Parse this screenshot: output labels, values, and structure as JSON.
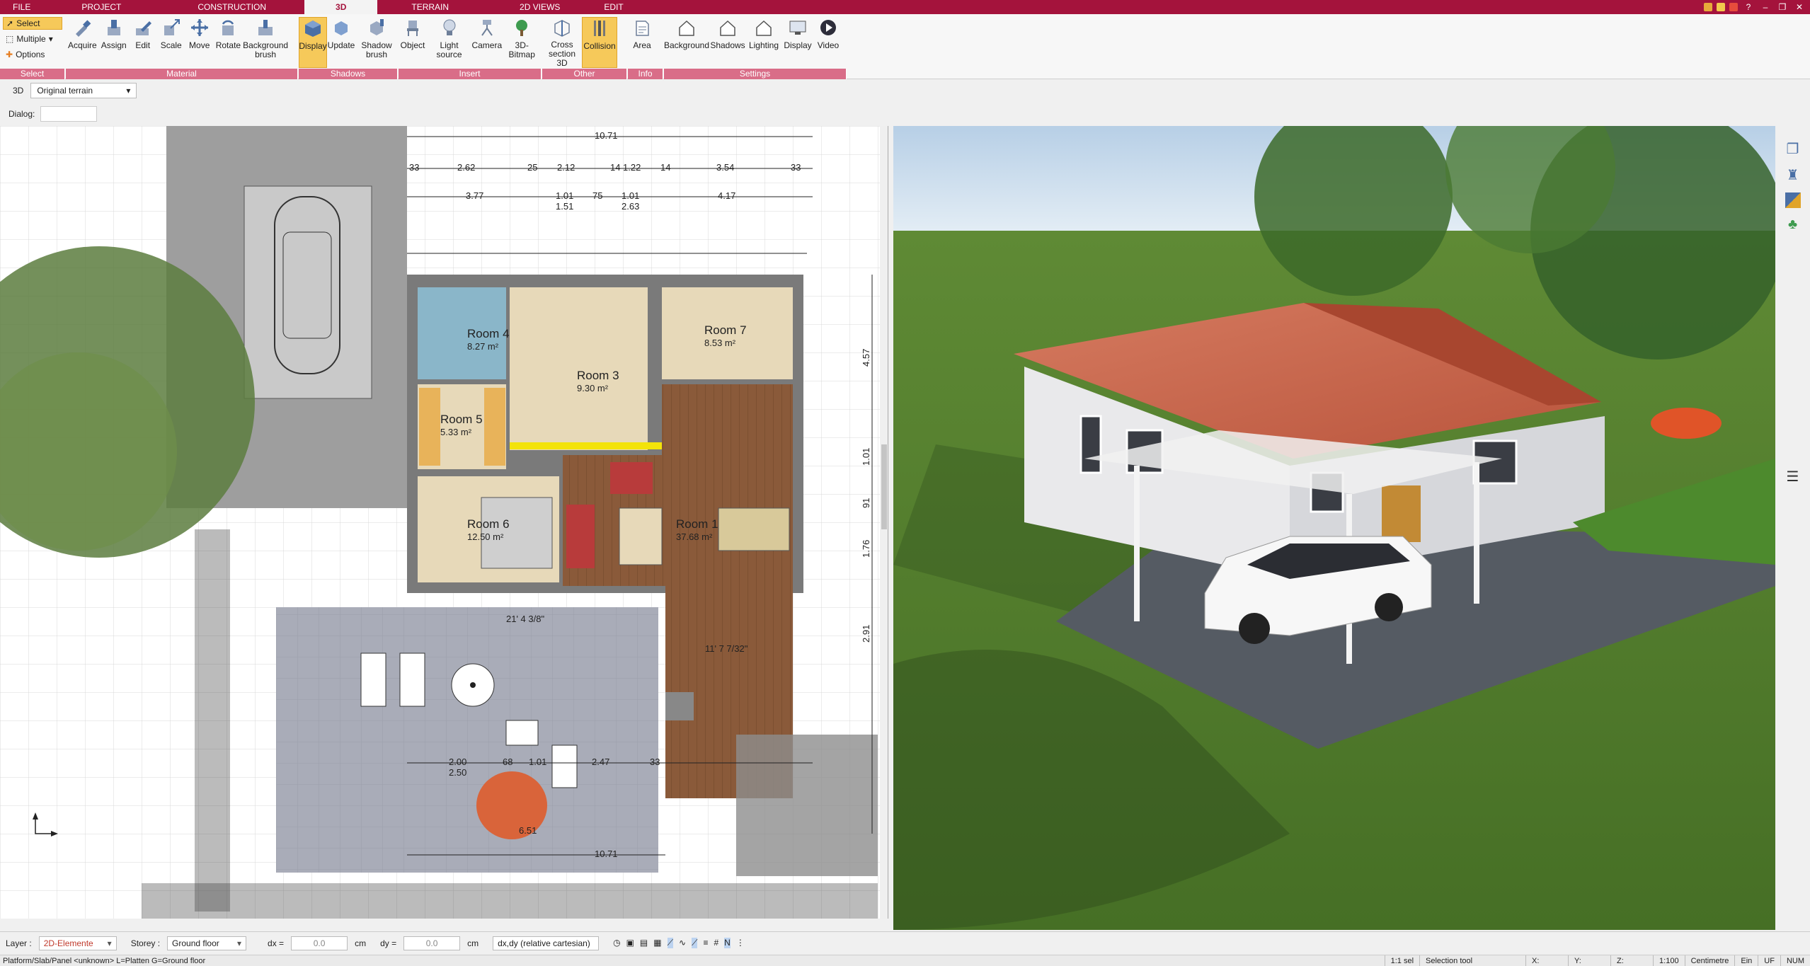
{
  "tabs": [
    {
      "label": "FILE"
    },
    {
      "label": "PROJECT"
    },
    {
      "label": "CONSTRUCTION"
    },
    {
      "label": "3D"
    },
    {
      "label": "TERRAIN"
    },
    {
      "label": "2D VIEWS"
    },
    {
      "label": "EDIT"
    }
  ],
  "ribbon": {
    "select": {
      "select_label": "Select",
      "multiple_label": "Multiple",
      "options_label": "Options",
      "group": "Select"
    },
    "material": {
      "group": "Material",
      "buttons": [
        "Acquire",
        "Assign",
        "Edit",
        "Scale",
        "Move",
        "Rotate",
        "Background brush"
      ]
    },
    "shadows": {
      "group": "Shadows",
      "buttons": [
        "Display",
        "Update",
        "Shadow brush"
      ]
    },
    "insert": {
      "group": "Insert",
      "buttons": [
        "Object",
        "Light source",
        "Camera",
        "3D-Bitmap"
      ]
    },
    "other": {
      "group": "Other",
      "buttons": [
        "Cross section 3D",
        "Collision"
      ]
    },
    "info": {
      "group": "Info",
      "buttons": [
        "Area"
      ]
    },
    "settings": {
      "group": "Settings",
      "buttons": [
        "Background",
        "Shadows",
        "Lighting",
        "Display",
        "Video"
      ]
    }
  },
  "subbar": {
    "mode": "3D",
    "terrain": "Original terrain"
  },
  "dialog": {
    "label": "Dialog:"
  },
  "plan": {
    "dims_top": [
      "10.71",
      "33",
      "2.62",
      "25",
      "2.12",
      "14",
      "1.22",
      "14",
      "3.54",
      "33",
      "3.77",
      "1.01",
      "75",
      "1.01",
      "4.17",
      "1.51",
      "2.63"
    ],
    "rooms": [
      {
        "name": "Room 4",
        "area": "8.27 m²"
      },
      {
        "name": "Room 7",
        "area": "8.53 m²"
      },
      {
        "name": "Room 3",
        "area": "9.30 m²"
      },
      {
        "name": "Room 5",
        "area": "5.33 m²"
      },
      {
        "name": "Room 6",
        "area": "12.50 m²"
      },
      {
        "name": "Room 1",
        "area": "37.68 m²"
      }
    ],
    "dims_bottom": [
      "2.00",
      "2.50",
      "68",
      "1.01",
      "2.47",
      "33",
      "10.71",
      "21' 4 3/8\"",
      "11' 7 7/32\"",
      "6.51"
    ],
    "dims_right": [
      "4.57",
      "1.01",
      "91",
      "1.76",
      "2.91"
    ]
  },
  "bottombar": {
    "layer_label": "Layer :",
    "layer_value": "2D-Elemente",
    "storey_label": "Storey :",
    "storey_value": "Ground floor",
    "dx_label": "dx =",
    "dx_value": "0.0",
    "dy_label": "dy =",
    "dy_value": "0.0",
    "unit": "cm",
    "coord_mode": "dx,dy (relative cartesian)"
  },
  "status": {
    "left": "Platform/Slab/Panel <unknown> L=Platten G=Ground floor",
    "tool": "Selection tool",
    "x": "X:",
    "y": "Y:",
    "z": "Z:",
    "scale": "1:100",
    "unit": "Centimetre",
    "ein": "Ein",
    "uf": "UF",
    "num": "NUM",
    "ratio": "1:1 sel"
  },
  "colors": {
    "accent": "#a4133c",
    "group_label": "#d96d88",
    "active_btn": "#f6c95a"
  }
}
